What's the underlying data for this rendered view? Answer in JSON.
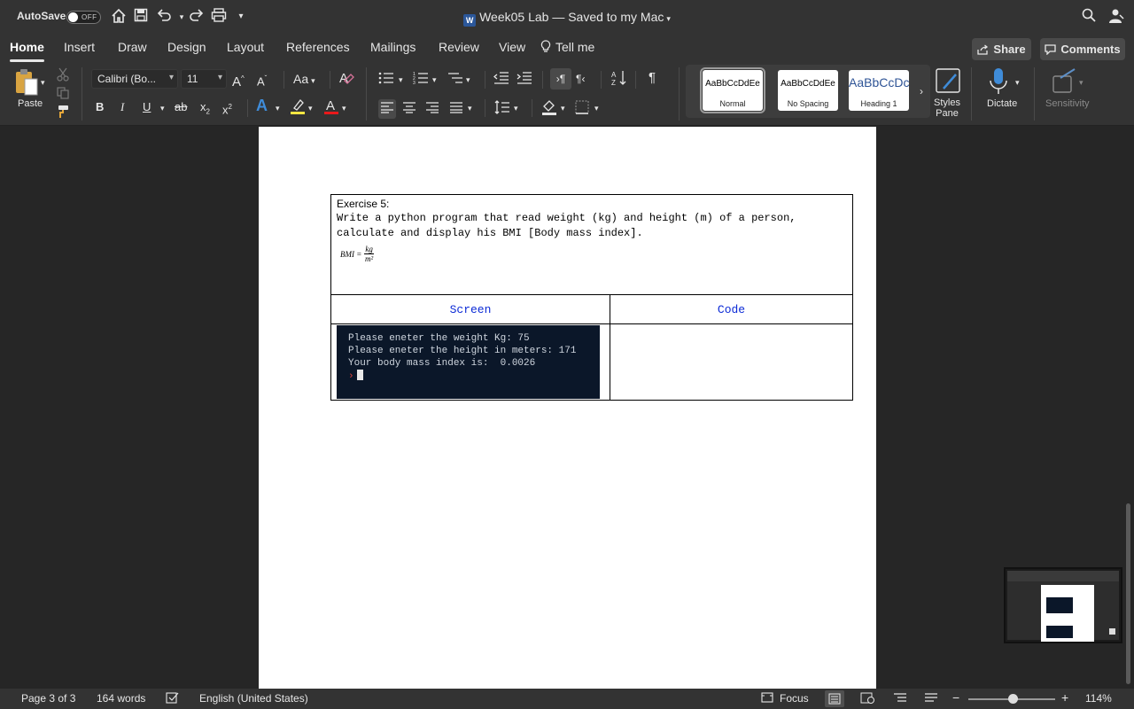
{
  "titlebar": {
    "autosave_label": "AutoSave",
    "autosave_state": "OFF",
    "document_title": "Week05 Lab — Saved to my Mac",
    "word_badge": "W"
  },
  "tabs": [
    {
      "label": "Home",
      "active": true
    },
    {
      "label": "Insert"
    },
    {
      "label": "Draw"
    },
    {
      "label": "Design"
    },
    {
      "label": "Layout"
    },
    {
      "label": "References"
    },
    {
      "label": "Mailings"
    },
    {
      "label": "Review"
    },
    {
      "label": "View"
    },
    {
      "label": "Tell me"
    }
  ],
  "actions": {
    "share_label": "Share",
    "comments_label": "Comments"
  },
  "ribbon": {
    "paste_label": "Paste",
    "font_name": "Calibri (Bo...",
    "font_size": "11",
    "grow_font": "A",
    "shrink_font": "A",
    "change_case": "Aa",
    "bold": "B",
    "italic": "I",
    "underline": "U",
    "strikethrough": "ab",
    "subscript": "x",
    "superscript": "x",
    "text_effects": "A",
    "font_color": "A",
    "highlight_color": "#f5e642",
    "font_color_value": "#e8191b",
    "styles": [
      {
        "sample": "AaBbCcDdEe",
        "name": "Normal",
        "selected": true
      },
      {
        "sample": "AaBbCcDdEe",
        "name": "No Spacing"
      },
      {
        "sample": "AaBbCcDc",
        "name": "Heading 1"
      }
    ],
    "styles_pane_label": "Styles Pane",
    "dictate_label": "Dictate",
    "sensitivity_label": "Sensitivity"
  },
  "document": {
    "exercise_title": "Exercise 5:",
    "exercise_text": "Write a python program that read weight (kg) and height (m) of a person, calculate and display his BMI [Body mass index].",
    "formula": {
      "lhs": "BMI =",
      "numerator": "kg",
      "denominator": "m²"
    },
    "col_screen": "Screen",
    "col_code": "Code",
    "terminal_lines": [
      "Please eneter the weight Kg: 75",
      "Please eneter the height in meters: 171",
      "Your body mass index is:  0.0026"
    ],
    "terminal_prompt": "›"
  },
  "status": {
    "page": "Page 3 of 3",
    "words": "164 words",
    "language": "English (United States)",
    "focus": "Focus",
    "zoom": "114%",
    "zoom_minus": "−",
    "zoom_plus": "+"
  },
  "colors": {
    "accent_blue": "#2b579a",
    "header_text_blue": "#0b2ad6",
    "terminal_bg": "#0b1729"
  }
}
